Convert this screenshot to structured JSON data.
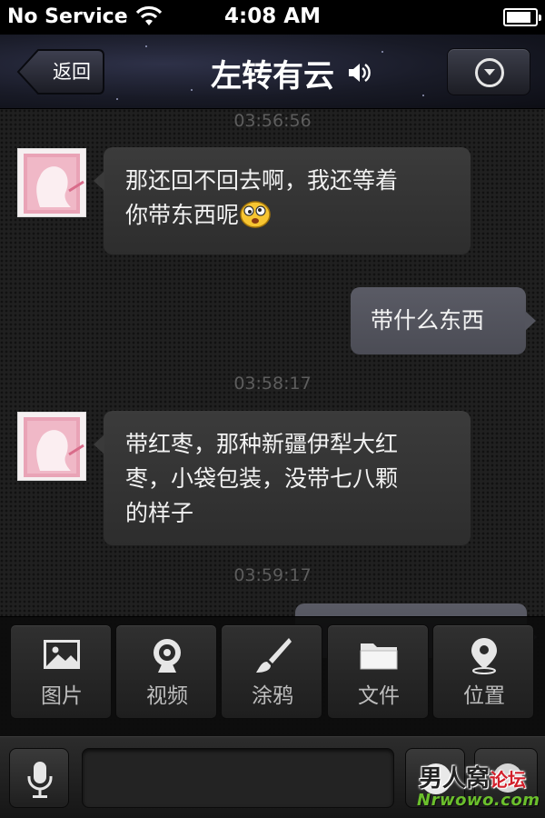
{
  "status_bar": {
    "carrier": "No Service",
    "time": "4:08 AM",
    "battery_level": 0.85
  },
  "nav": {
    "back_label": "返回",
    "title": "左转有云",
    "title_icon": "speaker-icon",
    "menu_icon": "chevron-down-circle-icon"
  },
  "messages": [
    {
      "type": "timestamp",
      "text": "03:56:56"
    },
    {
      "type": "incoming",
      "line1": "那还回不回去啊，我还等着",
      "line2": "你带东西呢",
      "emoji": "dizzy-face"
    },
    {
      "type": "outgoing",
      "text": "带什么东西"
    },
    {
      "type": "timestamp",
      "text": "03:58:17"
    },
    {
      "type": "incoming",
      "line1": "带红枣，那种新疆伊犁大红",
      "line2": "枣，小袋包装，没带七八颗",
      "line3": "的样子"
    },
    {
      "type": "timestamp",
      "text": "03:59:17"
    }
  ],
  "tools": [
    {
      "label": "图片",
      "icon": "image-icon"
    },
    {
      "label": "视频",
      "icon": "webcam-icon"
    },
    {
      "label": "涂鸦",
      "icon": "brush-icon"
    },
    {
      "label": "文件",
      "icon": "folder-icon"
    },
    {
      "label": "位置",
      "icon": "location-pin-icon"
    }
  ],
  "input": {
    "value": "",
    "placeholder": ""
  },
  "watermark": {
    "line1a": "男人窝",
    "line1b": "论坛",
    "line2": "Nrwowo.com"
  }
}
